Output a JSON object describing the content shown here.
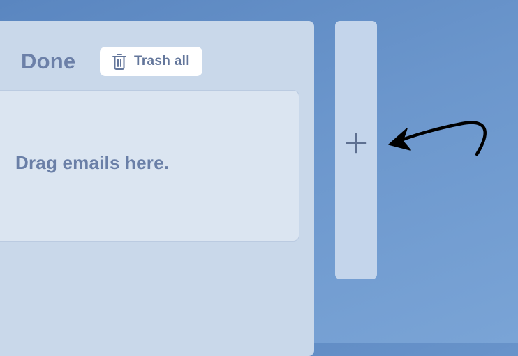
{
  "column": {
    "title": "Done",
    "trash_button": {
      "label": "Trash all",
      "icon": "trash-icon"
    },
    "drop_zone": {
      "placeholder": "Drag emails here."
    }
  },
  "add_column_button": {
    "icon": "plus-icon"
  },
  "annotation": {
    "icon": "curved-arrow-icon"
  },
  "colors": {
    "background": "#6b96cc",
    "column_bg": "#c9d8ea",
    "drop_zone_bg": "#dbe5f1",
    "add_column_bg": "#c4d5eb",
    "text": "#6c80a8"
  }
}
